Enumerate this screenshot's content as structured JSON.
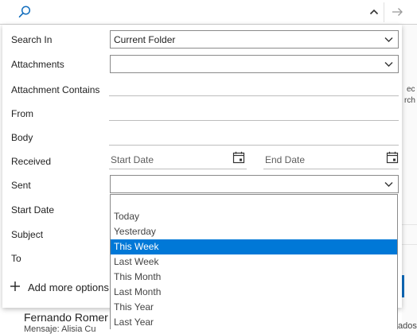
{
  "search": {
    "placeholder": ""
  },
  "fields": {
    "search_in": {
      "label": "Search In",
      "value": "Current Folder"
    },
    "attachments": {
      "label": "Attachments",
      "value": ""
    },
    "attachment_contains": {
      "label": "Attachment Contains"
    },
    "from": {
      "label": "From"
    },
    "body": {
      "label": "Body"
    },
    "received": {
      "label": "Received",
      "start_placeholder": "Start Date",
      "end_placeholder": "End Date"
    },
    "sent": {
      "label": "Sent",
      "value": ""
    },
    "start_date": {
      "label": "Start Date"
    },
    "subject": {
      "label": "Subject"
    },
    "to": {
      "label": "To"
    }
  },
  "add_more_options": "Add more options",
  "sent_dropdown": {
    "options": [
      "",
      "Today",
      "Yesterday",
      "This Week",
      "Last Week",
      "This Month",
      "Last Month",
      "This Year",
      "Last Year"
    ],
    "selected": "This Week"
  },
  "background": {
    "right_fragment_1": "ec",
    "right_fragment_2": "rch",
    "person_name": "Fernando Romer",
    "person_sub": "Mensaje: Alisia Cu",
    "trailing_word": "ados"
  },
  "colors": {
    "accent": "#0078d7",
    "brand_blue": "#0f6cbd"
  }
}
